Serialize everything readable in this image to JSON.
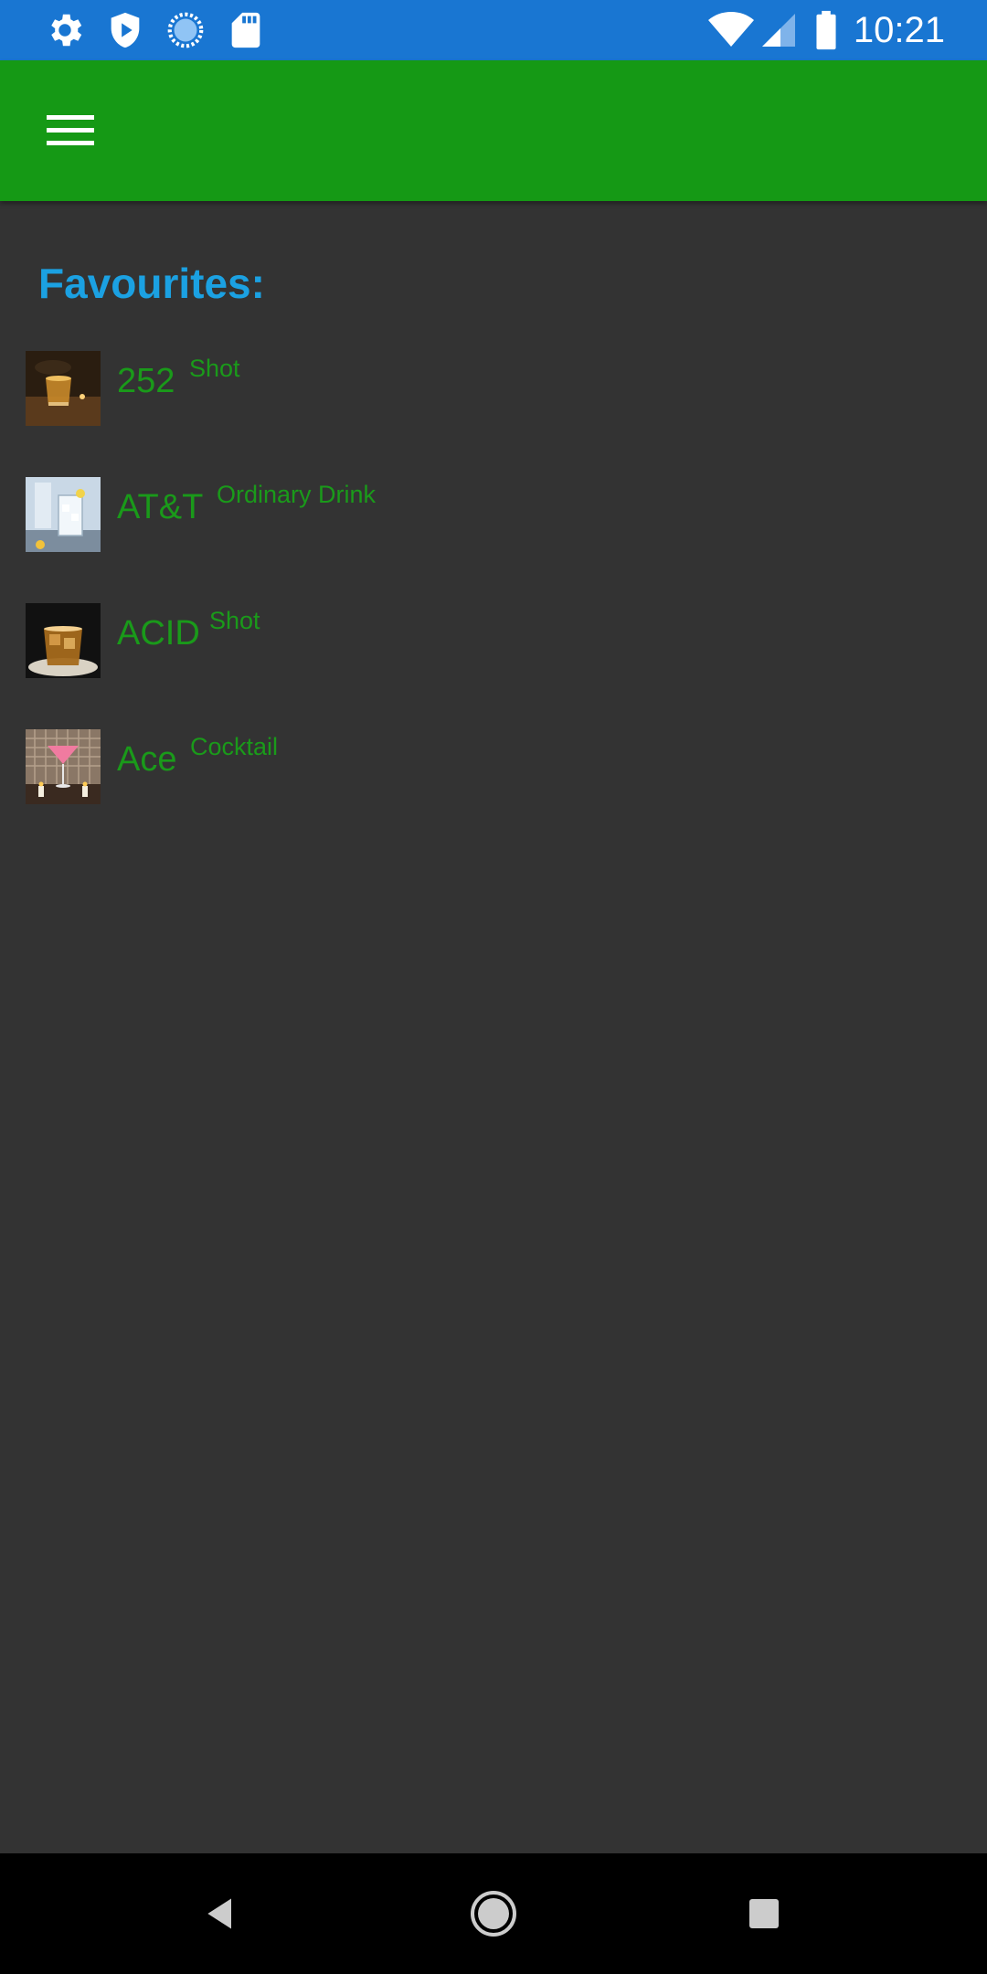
{
  "status_bar": {
    "time": "10:21",
    "left_icons": [
      "settings-icon",
      "shield-play-icon",
      "loading-circle-icon",
      "sd-card-icon"
    ],
    "right_icons": [
      "wifi-icon",
      "cell-signal-icon",
      "battery-icon"
    ]
  },
  "app_bar": {
    "menu_icon": "hamburger-menu-icon",
    "color": "#159915"
  },
  "favourites": {
    "title": "Favourites:",
    "items": [
      {
        "name": "252",
        "category": "Shot",
        "image": "shot-glass-whisky-thumbnail"
      },
      {
        "name": "AT&T",
        "category": "Ordinary Drink",
        "image": "highball-glass-thumbnail"
      },
      {
        "name": "ACID",
        "category": "Shot",
        "image": "rocks-glass-whisky-thumbnail"
      },
      {
        "name": "Ace",
        "category": "Cocktail",
        "image": "pink-martini-thumbnail"
      }
    ]
  },
  "nav_bar": {
    "icons": [
      "back-icon",
      "home-icon",
      "recents-icon"
    ]
  },
  "colors": {
    "status_bar": "#1976d2",
    "background": "#333333",
    "title_accent": "#1ba1e2",
    "item_text": "#1a9a1a"
  }
}
